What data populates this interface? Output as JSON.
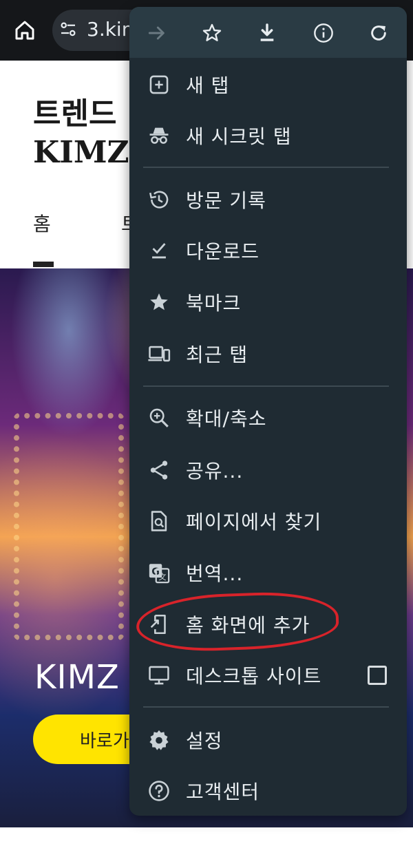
{
  "browser": {
    "url_text": "3.kim",
    "home_icon": "home-icon",
    "site_settings_icon": "tune-icon"
  },
  "page": {
    "title": "트렌드\nKIMZ",
    "nav_home": "홈",
    "nav_second": "트",
    "hero_text": "KIMZ",
    "hero_button": "바로가"
  },
  "menu": {
    "toolbar": [
      {
        "name": "forward-icon"
      },
      {
        "name": "bookmark-star-icon"
      },
      {
        "name": "download-icon"
      },
      {
        "name": "info-icon"
      },
      {
        "name": "reload-icon"
      }
    ],
    "items": [
      {
        "label": "새 탭",
        "icon": "new-tab-icon"
      },
      {
        "label": "새 시크릿 탭",
        "icon": "incognito-icon"
      },
      {
        "label": "방문 기록",
        "icon": "history-icon"
      },
      {
        "label": "다운로드",
        "icon": "download-check-icon"
      },
      {
        "label": "북마크",
        "icon": "star-icon"
      },
      {
        "label": "최근 탭",
        "icon": "devices-icon"
      },
      {
        "label": "확대/축소",
        "icon": "zoom-in-icon"
      },
      {
        "label": "공유...",
        "icon": "share-icon"
      },
      {
        "label": "페이지에서 찾기",
        "icon": "find-in-page-icon"
      },
      {
        "label": "번역...",
        "icon": "translate-icon"
      },
      {
        "label": "홈 화면에 추가",
        "icon": "add-to-home-icon"
      },
      {
        "label": "데스크톱 사이트",
        "icon": "desktop-icon",
        "checked": false
      },
      {
        "label": "설정",
        "icon": "settings-gear-icon"
      },
      {
        "label": "고객센터",
        "icon": "help-icon"
      }
    ]
  },
  "colors": {
    "menu_bg": "#1f2b33",
    "menu_toolbar_bg": "#2a3b44",
    "annotation": "#d8232a",
    "hero_button": "#ffe400"
  }
}
